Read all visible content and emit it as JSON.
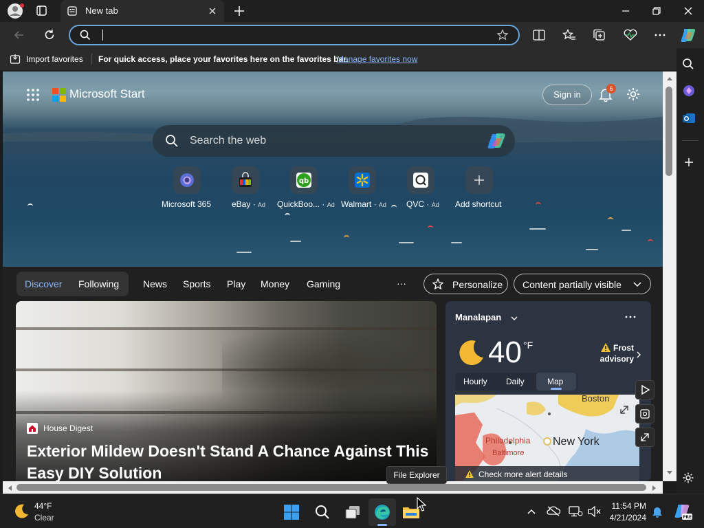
{
  "browser": {
    "tab_title": "New tab",
    "address_value": "",
    "favorites": {
      "import_label": "Import favorites",
      "hint": "For quick access, place your favorites here on the favorites bar.",
      "manage_link": "Manage favorites now"
    }
  },
  "start": {
    "brand": "Microsoft Start",
    "sign_in": "Sign in",
    "notification_count": "6",
    "search_placeholder": "Search the web",
    "shortcuts": [
      {
        "label": "Microsoft 365",
        "ad": ""
      },
      {
        "label": "eBay",
        "ad": "Ad"
      },
      {
        "label": "QuickBoo...",
        "ad": "Ad"
      },
      {
        "label": "Walmart",
        "ad": "Ad"
      },
      {
        "label": "QVC",
        "ad": "Ad"
      },
      {
        "label": "Add shortcut",
        "ad": ""
      }
    ],
    "nav": {
      "discover": "Discover",
      "following": "Following",
      "tabs": [
        "News",
        "Sports",
        "Play",
        "Money",
        "Gaming"
      ],
      "more": "···",
      "personalize": "Personalize",
      "content_visibility": "Content partially visible"
    },
    "story": {
      "source": "House Digest",
      "title": "Exterior Mildew Doesn't Stand A Chance Against This Easy DIY Solution"
    },
    "weather": {
      "location": "Manalapan",
      "temperature": "40",
      "unit": "°F",
      "alert_line1": "Frost",
      "alert_line2": "advisory",
      "tabs": [
        "Hourly",
        "Daily",
        "Map"
      ],
      "active_tab": "Map",
      "map_labels": {
        "boston": "Boston",
        "new_york": "New York",
        "philadelphia": "Philadelphia",
        "baltimore": "Baltimore"
      },
      "alert_details": "Check more alert details"
    },
    "tooltip": "File Explorer"
  },
  "taskbar": {
    "weather_temp": "44°F",
    "weather_cond": "Clear",
    "time": "11:54 PM",
    "date": "4/21/2024"
  },
  "colors": {
    "accent": "#69a6dd",
    "discover": "#8ab4f8",
    "badge": "#d9532b",
    "alert_yellow": "#f2c230"
  }
}
